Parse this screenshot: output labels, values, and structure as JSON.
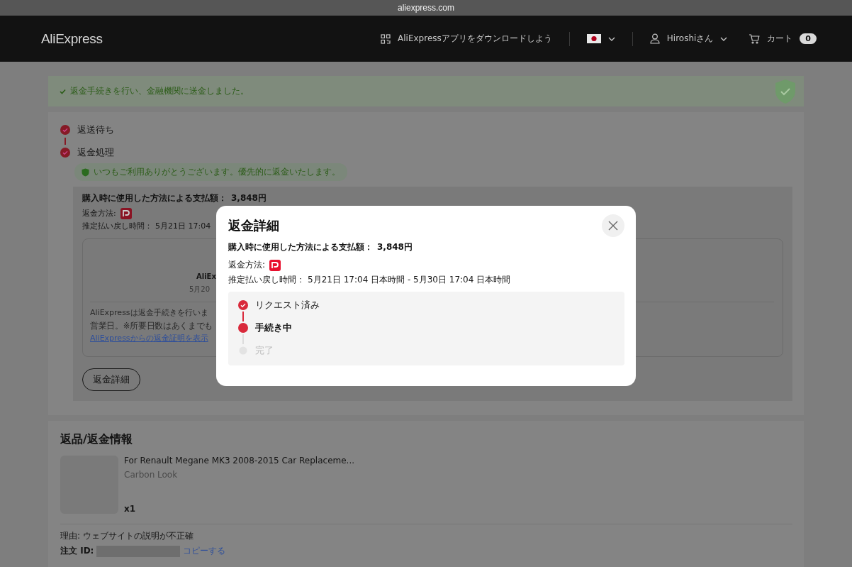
{
  "browser_bar": {
    "url": "aliexpress.com"
  },
  "header": {
    "logo": "AliExpress",
    "app_download": "AliExpressアプリをダウンロードしよう",
    "user": "Hiroshiさん",
    "cart": {
      "label": "カート",
      "count": "0"
    }
  },
  "banner": {
    "text": "返金手続きを行い、金融機関に送金しました。"
  },
  "progress": {
    "steps": [
      {
        "label": "返送待ち",
        "done": true
      },
      {
        "label": "返金処理",
        "done": true
      }
    ],
    "notice": "いつもご利用ありがとうございます。優先的に返金いたします。"
  },
  "refund_summary": {
    "amount_label": "購入時に使用した方法による支払額：",
    "amount": "3,848円",
    "method_label": "返金方法:",
    "estimate_label": "推定払い戻し時間：",
    "estimate_value": "5月21日 17:04",
    "receipt": {
      "title": "AliEx",
      "date": "5月20",
      "lines": [
        "AliExpressは返金手続きを行いま",
        "営業日。※所要日数はあくまでも"
      ],
      "link": "AliExpressからの返金証明を表示"
    },
    "details_button": "返金詳細"
  },
  "return_info": {
    "title": "返品/返金情報",
    "product": {
      "name": "For Renault Megane MK3 2008-2015 Car Replaceme...",
      "variant": "Carbon Look",
      "quantity": "x1"
    },
    "reason_label": "理由:",
    "reason": "ウェブサイトの説明が不正確",
    "order_id_label": "注文 ID:",
    "copy_link": "コピーする"
  },
  "modal": {
    "title": "返金詳細",
    "amount_label": "購入時に使用した方法による支払額：",
    "amount": "3,848円",
    "method_label": "返金方法:",
    "estimate_label": "推定払い戻し時間：",
    "estimate_value": "5月21日 17:04 日本時間 - 5月30日 17:04 日本時間",
    "steps": [
      {
        "label": "リクエスト済み",
        "done": true,
        "current": false
      },
      {
        "label": "手続き中",
        "done": false,
        "current": true
      },
      {
        "label": "完了",
        "done": false,
        "current": false
      }
    ]
  }
}
